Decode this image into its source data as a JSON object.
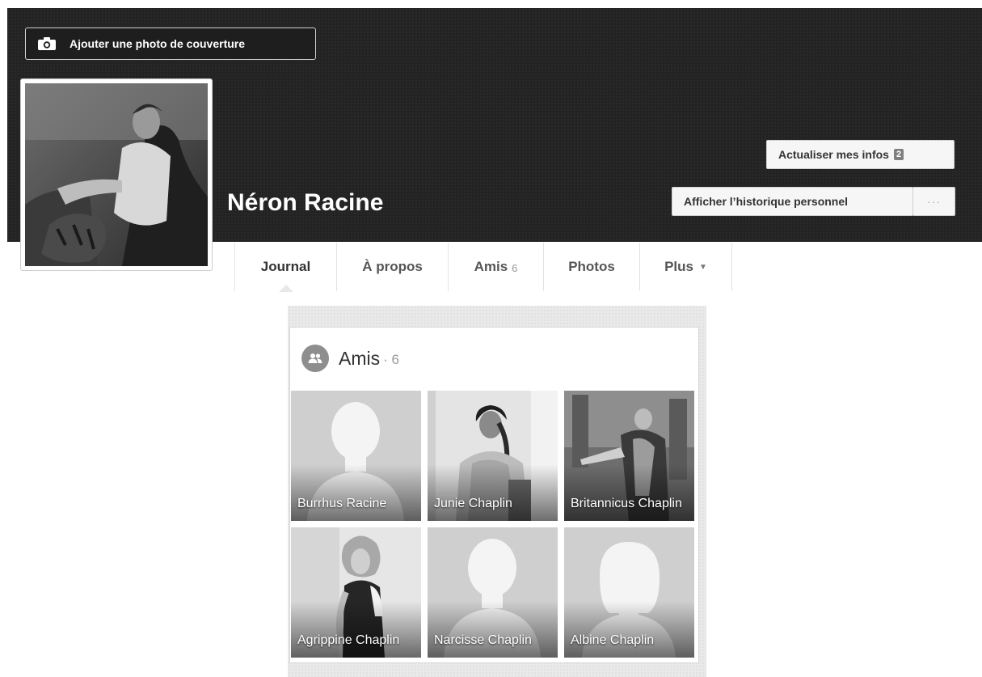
{
  "cover": {
    "add_cover_label": "Ajouter une photo de couverture",
    "camera_icon": "camera-icon"
  },
  "profile": {
    "name": "Néron Racine"
  },
  "actions": {
    "update_info_label": "Actualiser mes infos",
    "update_info_badge": "2",
    "history_label": "Afficher l’historique personnel",
    "more_label": "···"
  },
  "tabs": [
    {
      "label": "Journal",
      "count": "",
      "active": true
    },
    {
      "label": "À propos",
      "count": ""
    },
    {
      "label": "Amis",
      "count": "6"
    },
    {
      "label": "Photos",
      "count": ""
    },
    {
      "label": "Plus",
      "caret": "▼"
    }
  ],
  "friends_card": {
    "title": "Amis",
    "count": "· 6",
    "icon": "friends-icon",
    "friends": [
      {
        "name": "Burrhus Racine",
        "photo": "silhouette-male"
      },
      {
        "name": "Junie Chaplin",
        "photo": "photo"
      },
      {
        "name": "Britannicus Chaplin",
        "photo": "photo"
      },
      {
        "name": "Agrippine Chaplin",
        "photo": "photo"
      },
      {
        "name": "Narcisse Chaplin",
        "photo": "silhouette-male"
      },
      {
        "name": "Albine Chaplin",
        "photo": "silhouette-female"
      }
    ]
  }
}
